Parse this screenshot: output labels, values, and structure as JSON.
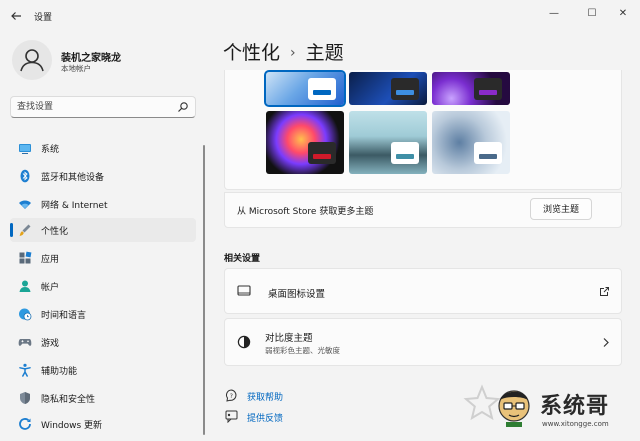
{
  "window": {
    "title": "设置",
    "controls": [
      "—",
      "☐",
      "✕"
    ]
  },
  "profile": {
    "name": "装机之家晓龙",
    "account_type": "本地帐户"
  },
  "search": {
    "placeholder": "查找设置"
  },
  "sidebar": {
    "items": [
      {
        "label": "系统",
        "icon": "monitor-icon"
      },
      {
        "label": "蓝牙和其他设备",
        "icon": "bluetooth-icon"
      },
      {
        "label": "网络 & Internet",
        "icon": "wifi-icon"
      },
      {
        "label": "个性化",
        "icon": "brush-icon",
        "active": true
      },
      {
        "label": "应用",
        "icon": "apps-icon"
      },
      {
        "label": "帐户",
        "icon": "person-icon"
      },
      {
        "label": "时间和语言",
        "icon": "globe-clock-icon"
      },
      {
        "label": "游戏",
        "icon": "gamepad-icon"
      },
      {
        "label": "辅助功能",
        "icon": "accessibility-icon"
      },
      {
        "label": "隐私和安全性",
        "icon": "shield-icon"
      },
      {
        "label": "Windows 更新",
        "icon": "update-icon"
      }
    ]
  },
  "breadcrumb": {
    "parent": "个性化",
    "separator": "›",
    "current": "主题"
  },
  "themes": {
    "store_text": "从 Microsoft Store 获取更多主题",
    "browse_button": "浏览主题"
  },
  "related": {
    "title": "相关设置",
    "desktop_icons": "桌面图标设置",
    "contrast_title": "对比度主题",
    "contrast_sub": "弱视彩色主题、光敏度"
  },
  "help": {
    "get_help": "获取帮助",
    "feedback": "提供反馈"
  },
  "watermark": {
    "brand": "系统哥",
    "url": "www.xitongge.com"
  },
  "colors": {
    "accent": "#0067c0",
    "background": "#f3f3f3",
    "panel": "#fbfbfb"
  }
}
